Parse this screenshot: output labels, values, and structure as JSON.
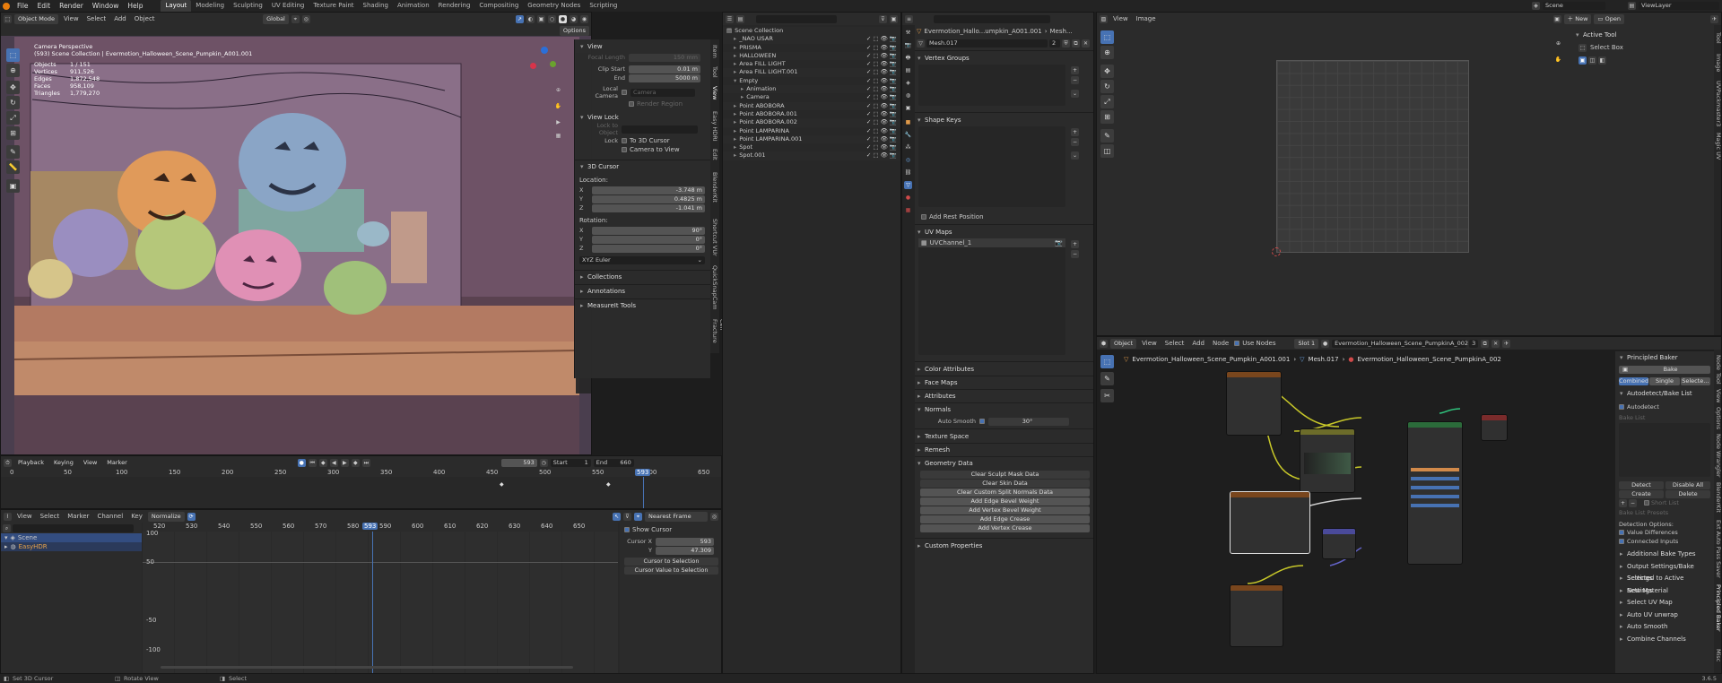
{
  "topbar": {
    "menus": [
      "File",
      "Edit",
      "Render",
      "Window",
      "Help"
    ],
    "workspaces": [
      "Layout",
      "Modeling",
      "Sculpting",
      "UV Editing",
      "Texture Paint",
      "Shading",
      "Animation",
      "Rendering",
      "Compositing",
      "Geometry Nodes",
      "Scripting"
    ],
    "active_workspace": "Layout",
    "scene": "Scene",
    "view_layer": "ViewLayer"
  },
  "viewport": {
    "mode": "Object Mode",
    "menus": [
      "View",
      "Select",
      "Add",
      "Object"
    ],
    "transform": "Global",
    "options": "Options",
    "overlay_title": "Camera Perspective",
    "overlay_collection": "(593) Scene Collection | Evermotion_Halloween_Scene_Pumpkin_A001.001",
    "stats": [
      {
        "k": "Objects",
        "v": "1 / 151"
      },
      {
        "k": "Vertices",
        "v": "911,526"
      },
      {
        "k": "Edges",
        "v": "1,872,548"
      },
      {
        "k": "Faces",
        "v": "958,109"
      },
      {
        "k": "Triangles",
        "v": "1,779,270"
      }
    ],
    "sidebar": {
      "view_head": "View",
      "focal_length_label": "Focal Length",
      "focal_length": "150 mm",
      "clip_start_label": "Clip Start",
      "clip_start": "0.01 m",
      "end_label": "End",
      "clip_end": "5000 m",
      "local_camera_label": "Local Camera",
      "local_camera": "Camera",
      "render_region": "Render Region",
      "view_lock_head": "View Lock",
      "lock_to_object": "Lock to Object",
      "lock_label": "Lock",
      "to_3d_cursor": "To 3D Cursor",
      "camera_to_view": "Camera to View",
      "cursor_head": "3D Cursor",
      "location_label": "Location:",
      "x_label": "X",
      "y_label": "Y",
      "z_label": "Z",
      "loc_x": "-3.748 m",
      "loc_y": "0.4825 m",
      "loc_z": "-1.041 m",
      "rotation_label": "Rotation:",
      "rot_x": "90°",
      "rot_y": "0°",
      "rot_z": "0°",
      "rot_mode": "XYZ Euler",
      "collections": "Collections",
      "annotations": "Annotations",
      "measureit": "MeasureIt Tools"
    },
    "vtabs": [
      "Item",
      "Tool",
      "View",
      "Easy HDRI",
      "Edit",
      "BlenderKit",
      "Shortcut VUr",
      "QuickSnapCam",
      "Cell Fracture"
    ]
  },
  "timeline": {
    "menus": [
      "Playback",
      "Keying",
      "View",
      "Marker"
    ],
    "current": "593",
    "start_label": "Start",
    "start": "1",
    "end_label": "End",
    "end": "660",
    "ruler": [
      "0",
      "50",
      "100",
      "150",
      "200",
      "250",
      "300",
      "350",
      "400",
      "450",
      "500",
      "550",
      "600",
      "650"
    ],
    "playhead": "593"
  },
  "graph": {
    "menus": [
      "View",
      "Select",
      "Marker",
      "Channel",
      "Key"
    ],
    "normalize": "Normalize",
    "interp": "Nearest Frame",
    "channels": [
      "Scene",
      "EasyHDR"
    ],
    "ruler": [
      "520",
      "530",
      "540",
      "550",
      "560",
      "570",
      "580",
      "590",
      "600",
      "610",
      "620",
      "630",
      "640",
      "650",
      "660"
    ],
    "playhead": "593",
    "yticks": [
      "100",
      "50",
      "-50",
      "-100"
    ],
    "show_cursor": "Show Cursor",
    "cursor_x_label": "Cursor X",
    "cursor_x": "593",
    "cursor_y_label": "Y",
    "cursor_y": "47.309",
    "cursor_to_selection": "Cursor to Selection",
    "cursor_value_to_selection": "Cursor Value to Selection"
  },
  "outliner": {
    "root": "Scene Collection",
    "items": [
      {
        "name": "_NAO USAR",
        "indent": 1,
        "icon": "▸"
      },
      {
        "name": "PRISMA",
        "indent": 1,
        "icon": "▸"
      },
      {
        "name": "HALLOWEEN",
        "indent": 1,
        "icon": "▸"
      },
      {
        "name": "Area FILL LIGHT",
        "indent": 1,
        "icon": "▸"
      },
      {
        "name": "Area FILL LIGHT.001",
        "indent": 1,
        "icon": "▸"
      },
      {
        "name": "Empty",
        "indent": 1,
        "icon": "▾"
      },
      {
        "name": "Animation",
        "indent": 2,
        "icon": "▸"
      },
      {
        "name": "Camera",
        "indent": 2,
        "icon": "▸"
      },
      {
        "name": "Point ABOBORA",
        "indent": 1,
        "icon": "▸"
      },
      {
        "name": "Point ABOBORA.001",
        "indent": 1,
        "icon": "▸"
      },
      {
        "name": "Point ABOBORA.002",
        "indent": 1,
        "icon": "▸"
      },
      {
        "name": "Point LAMPARINA",
        "indent": 1,
        "icon": "▸"
      },
      {
        "name": "Point LAMPARINA.001",
        "indent": 1,
        "icon": "▸"
      },
      {
        "name": "Spot",
        "indent": 1,
        "icon": "▸"
      },
      {
        "name": "Spot.001",
        "indent": 1,
        "icon": "▸"
      }
    ]
  },
  "properties": {
    "breadcrumb_obj": "Evermotion_Hallo...umpkin_A001.001",
    "breadcrumb_mesh": "Mesh...",
    "mesh_name": "Mesh.017",
    "users": "2",
    "vertex_groups": "Vertex Groups",
    "shape_keys": "Shape Keys",
    "add_rest_position": "Add Rest Position",
    "uv_maps": "UV Maps",
    "uv_channel": "UVChannel_1",
    "color_attributes": "Color Attributes",
    "face_maps": "Face Maps",
    "attributes": "Attributes",
    "normals": "Normals",
    "auto_smooth": "Auto Smooth",
    "auto_smooth_angle": "30°",
    "texture_space": "Texture Space",
    "remesh": "Remesh",
    "geometry_data": "Geometry Data",
    "geo_buttons": [
      "Clear Sculpt Mask Data",
      "Clear Skin Data",
      "Clear Custom Split Normals Data",
      "Add Edge Bevel Weight",
      "Add Vertex Bevel Weight",
      "Add Edge Crease",
      "Add Vertex Crease"
    ],
    "custom_properties": "Custom Properties"
  },
  "image_editor": {
    "menus": [
      "View",
      "Image"
    ],
    "new": "New",
    "open": "Open",
    "active_tool": "Active Tool",
    "select_box": "Select Box",
    "vtabs": [
      "Tool",
      "Image",
      "UVPackmaster3",
      "Magic UV"
    ]
  },
  "node_editor": {
    "type": "Object",
    "menus": [
      "View",
      "Select",
      "Add",
      "Node"
    ],
    "use_nodes": "Use Nodes",
    "slot": "Slot 1",
    "material": "Evermotion_Halloween_Scene_PumpkinA_002",
    "users": "3",
    "bc_obj": "Evermotion_Halloween_Scene_Pumpkin_A001.001",
    "bc_mesh": "Mesh.017",
    "bc_mat": "Evermotion_Halloween_Scene_PumpkinA_002",
    "baker_head": "Principled Baker",
    "bake": "Bake",
    "combined": "Combined",
    "single": "Single",
    "selected": "Selecte...",
    "autodetect_list": "Autodetect/Bake List",
    "autodetect": "Autodetect",
    "bake_list": "Bake List",
    "detect": "Detect",
    "disable_all": "Disable All",
    "create": "Create",
    "delete": "Delete",
    "short_list": "Short List",
    "bake_list_presets": "Bake List Presets",
    "detection_options": "Detection Options:",
    "value_differences": "Value Differences",
    "connected_inputs": "Connected Inputs",
    "subpanels": [
      "Additional Bake Types",
      "Output Settings/Bake Settings",
      "Selected to Active Settings",
      "New Material",
      "Select UV Map",
      "Auto UV unwrap",
      "Auto Smooth",
      "Combine Channels"
    ],
    "vtabs": [
      "Node",
      "Tool",
      "View",
      "Options",
      "Node Wrangler",
      "BlenderKit",
      "Ext Auto Pass Saver",
      "Principled Baker",
      "Misc"
    ]
  },
  "status_bar": {
    "left1": "Set 3D Cursor",
    "left2": "Rotate View",
    "left3": "Select",
    "version": "3.6.5"
  }
}
